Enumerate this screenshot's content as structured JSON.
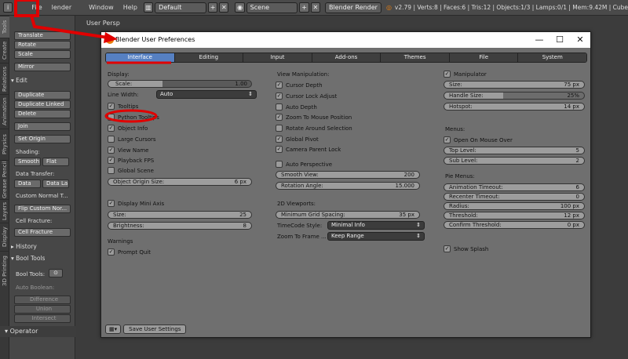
{
  "topbar": {
    "menus": [
      "File",
      "lender",
      "Window",
      "Help"
    ],
    "layout": "Default",
    "scene": "Scene",
    "engine": "Blender Render",
    "stats": "v2.79 | Verts:8 | Faces:6 | Tris:12 | Objects:1/3 | Lamps:0/1 | Mem:9.42M | Cube"
  },
  "side_tabs": [
    "Tools",
    "Create",
    "Relations",
    "Animation",
    "Physics",
    "Grease Pencil",
    "Layers",
    "Display",
    "3D Printing"
  ],
  "shelf": {
    "transform": [
      "Translate",
      "Rotate",
      "Scale"
    ],
    "mirror": "Mirror",
    "edit_head": "Edit",
    "edit": [
      "Duplicate",
      "Duplicate Linked",
      "Delete"
    ],
    "join": "Join",
    "set_origin": "Set Origin",
    "shading": "Shading:",
    "smooth": "Smooth",
    "flat": "Flat",
    "data_transfer": "Data Transfer:",
    "data": "Data",
    "data_la": "Data La",
    "custom_normal": "Custom Normal T...",
    "flip_custom": "Flip Custom Nor...",
    "cell_fracture_h": "Cell Fracture:",
    "cell_fracture": "Cell Fracture",
    "history": "History",
    "bool_tools_h": "Bool Tools",
    "bool_tools": "Bool Tools:",
    "auto_boolean": "Auto Boolean:",
    "difference": "Difference",
    "union": "Union",
    "intersect": "Intersect",
    "operator": "Operator"
  },
  "view_label": "User Persp",
  "window": {
    "title": "Blender User Preferences",
    "min": "—",
    "max": "☐",
    "close": "✕",
    "tabs": [
      "Interface",
      "Editing",
      "Input",
      "Add-ons",
      "Themes",
      "File",
      "System"
    ],
    "active_tab": "Interface",
    "display": {
      "heading": "Display:",
      "scale_label": "Scale:",
      "scale_value": "1.00",
      "line_width_label": "Line Width:",
      "line_width_value": "Auto",
      "checks": [
        {
          "label": "Tooltips",
          "checked": true
        },
        {
          "label": "Python Tooltips",
          "checked": false
        },
        {
          "label": "Object Info",
          "checked": true
        },
        {
          "label": "Large Cursors",
          "checked": false
        },
        {
          "label": "View Name",
          "checked": true
        },
        {
          "label": "Playback FPS",
          "checked": true
        },
        {
          "label": "Global Scene",
          "checked": false
        }
      ],
      "origin_size_label": "Object Origin Size:",
      "origin_size_value": "6 px",
      "mini_axis_label": "Display Mini Axis",
      "size_label": "Size:",
      "size_value": "25",
      "brightness_label": "Brightness:",
      "brightness_value": "8",
      "warnings": "Warnings",
      "prompt_quit": "Prompt Quit"
    },
    "view_manip": {
      "heading": "View Manipulation:",
      "checks": [
        {
          "label": "Cursor Depth",
          "checked": true
        },
        {
          "label": "Cursor Lock Adjust",
          "checked": true
        },
        {
          "label": "Auto Depth",
          "checked": false
        },
        {
          "label": "Zoom To Mouse Position",
          "checked": true
        },
        {
          "label": "Rotate Around Selection",
          "checked": false
        },
        {
          "label": "Global Pivot",
          "checked": true
        },
        {
          "label": "Camera Parent Lock",
          "checked": true
        }
      ],
      "auto_persp": "Auto Perspective",
      "smooth_view_label": "Smooth View:",
      "smooth_view_value": "200",
      "rotation_angle_label": "Rotation Angle:",
      "rotation_angle_value": "15.000",
      "viewports_heading": "2D Viewports:",
      "min_grid_label": "Minimum Grid Spacing:",
      "min_grid_value": "35 px",
      "timecode_label": "TimeCode Style:",
      "timecode_value": "Minimal Info",
      "zoom_frame_label": "Zoom To Frame ...",
      "zoom_frame_value": "Keep Range"
    },
    "manipulator": {
      "label": "Manipulator",
      "size_label": "Size:",
      "size_value": "75 px",
      "handle_label": "Handle Size:",
      "handle_value": "25%",
      "hotspot_label": "Hotspot:",
      "hotspot_value": "14 px",
      "menus_heading": "Menus:",
      "open_on_mouse": "Open On Mouse Over",
      "top_level_label": "Top Level:",
      "top_level_value": "5",
      "sub_level_label": "Sub Level:",
      "sub_level_value": "2",
      "pie_heading": "Pie Menus:",
      "anim_timeout_label": "Animation Timeout:",
      "anim_timeout_value": "6",
      "recenter_label": "Recenter Timeout:",
      "recenter_value": "0",
      "radius_label": "Radius:",
      "radius_value": "100 px",
      "threshold_label": "Threshold:",
      "threshold_value": "12 px",
      "confirm_label": "Confirm Threshold:",
      "confirm_value": "0 px",
      "show_splash": "Show Splash"
    },
    "footer": {
      "save": "Save User Settings"
    }
  },
  "colors": {
    "annotation": "#e00000",
    "active_tab": "#5680c2"
  }
}
